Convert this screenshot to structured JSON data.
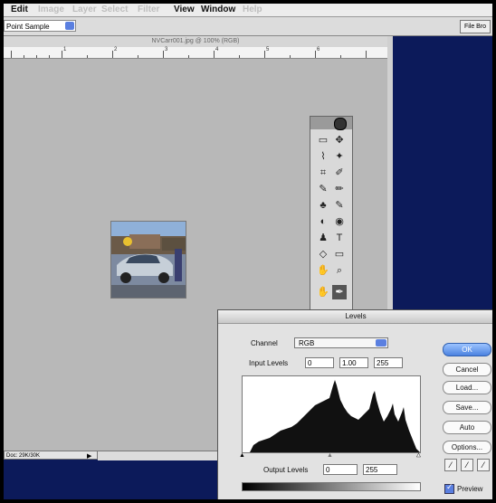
{
  "menu": [
    "Edit",
    "Image",
    "Layer",
    "Select",
    "Filter",
    "View",
    "Window",
    "Help"
  ],
  "options": {
    "sample": "Point Sample",
    "palette_button": "File Bro"
  },
  "document": {
    "title": "NVCarr001.jpg @ 100% (RGB)",
    "ruler": [
      "1",
      "2",
      "3",
      "4",
      "5",
      "6"
    ],
    "status": "Doc: 29K/30K"
  },
  "toolbox_tools": [
    "▭",
    "✥",
    "⌇",
    "✦",
    "⌗",
    "✐",
    "✎",
    "✏",
    "♣",
    "✎",
    "◐",
    "◉",
    "♟",
    "T",
    "◇",
    "▭",
    "✋",
    "⌕"
  ],
  "levels": {
    "title": "Levels",
    "channel_label": "Channel",
    "channel_value": "RGB",
    "input_label": "Input Levels",
    "input_values": [
      "0",
      "1.00",
      "255"
    ],
    "output_label": "Output Levels",
    "output_values": [
      "0",
      "255"
    ],
    "buttons": [
      "OK",
      "Cancel",
      "Load...",
      "Save...",
      "Auto",
      "Options..."
    ],
    "preview_label": "Preview",
    "preview_checked": true
  }
}
